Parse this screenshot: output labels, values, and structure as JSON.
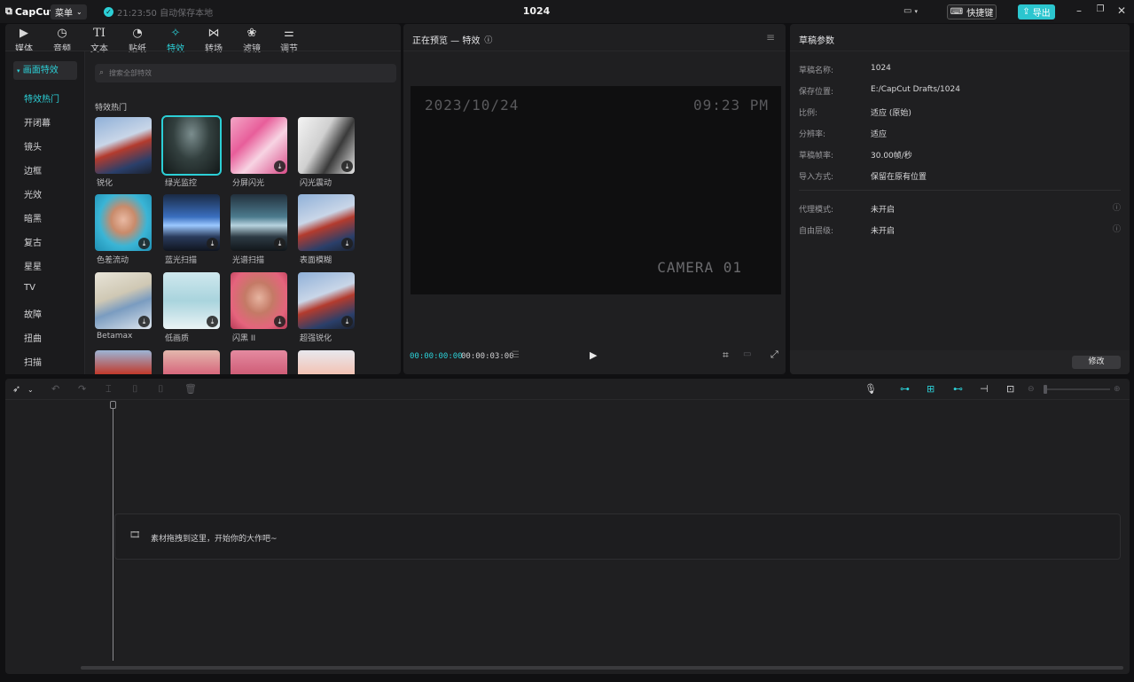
{
  "titlebar": {
    "logo": "CapCut",
    "menu_label": "菜单",
    "save_status": "21:23:50 自动保存本地",
    "project_title": "1024",
    "shortcut_label": "快捷键",
    "export_label": "导出"
  },
  "tabs": [
    {
      "label": "媒体",
      "icon": "media-icon"
    },
    {
      "label": "音频",
      "icon": "audio-icon"
    },
    {
      "label": "文本",
      "icon": "text-icon"
    },
    {
      "label": "贴纸",
      "icon": "sticker-icon"
    },
    {
      "label": "特效",
      "icon": "effects-icon",
      "active": true
    },
    {
      "label": "转场",
      "icon": "transition-icon"
    },
    {
      "label": "滤镜",
      "icon": "filter-icon"
    },
    {
      "label": "调节",
      "icon": "adjust-icon"
    }
  ],
  "sidebar": {
    "header": "画面特效",
    "items": [
      "特效热门",
      "开闭幕",
      "镜头",
      "边框",
      "光效",
      "暗黑",
      "复古",
      "星星",
      "TV",
      "故障",
      "扭曲",
      "扫描"
    ]
  },
  "search": {
    "placeholder": "搜索全部特效"
  },
  "effects": {
    "section_title": "特效热门",
    "items": [
      {
        "label": "锐化"
      },
      {
        "label": "绿光监控"
      },
      {
        "label": "分屏闪光"
      },
      {
        "label": "闪光震动"
      },
      {
        "label": "色差流动"
      },
      {
        "label": "蓝光扫描"
      },
      {
        "label": "光谱扫描"
      },
      {
        "label": "表面模糊"
      },
      {
        "label": "Betamax"
      },
      {
        "label": "低画质"
      },
      {
        "label": "闪黑 II"
      },
      {
        "label": "超强锐化"
      }
    ]
  },
  "preview": {
    "title": "正在预览 — 特效",
    "overlay_date": "2023/10/24",
    "overlay_time": "09:23 PM",
    "overlay_camera": "CAMERA 01",
    "current_time": "00:00:00:00",
    "total_time": "00:00:03:00"
  },
  "draft": {
    "title": "草稿参数",
    "rows": [
      {
        "label": "草稿名称:",
        "value": "1024"
      },
      {
        "label": "保存位置:",
        "value": "E:/CapCut Drafts/1024"
      },
      {
        "label": "比例:",
        "value": "适应 (原始)"
      },
      {
        "label": "分辨率:",
        "value": "适应"
      },
      {
        "label": "草稿帧率:",
        "value": "30.00帧/秒"
      },
      {
        "label": "导入方式:",
        "value": "保留在原有位置"
      }
    ],
    "rows2": [
      {
        "label": "代理模式:",
        "value": "未开启"
      },
      {
        "label": "自由层级:",
        "value": "未开启"
      }
    ],
    "modify_label": "修改"
  },
  "timeline": {
    "drop_text": "素材拖拽到这里，开始你的大作吧~"
  },
  "colors": {
    "accent": "#2ccfd6",
    "panel": "#1f1f21",
    "background": "#101012"
  }
}
